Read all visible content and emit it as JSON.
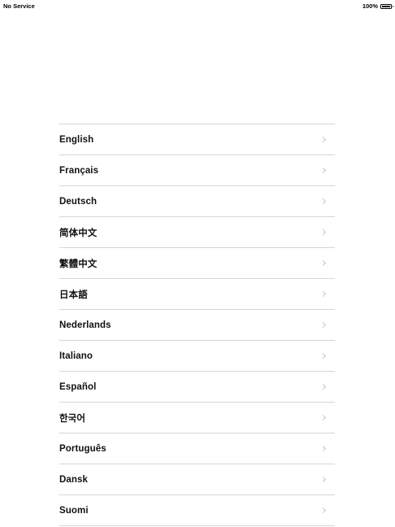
{
  "status_bar": {
    "carrier": "No Service",
    "battery_percent_label": "100%",
    "battery_level": 1.0
  },
  "language_list": {
    "items": [
      {
        "label": "English"
      },
      {
        "label": "Français"
      },
      {
        "label": "Deutsch"
      },
      {
        "label": "简体中文"
      },
      {
        "label": "繁體中文"
      },
      {
        "label": "日本語"
      },
      {
        "label": "Nederlands"
      },
      {
        "label": "Italiano"
      },
      {
        "label": "Español"
      },
      {
        "label": "한국어"
      },
      {
        "label": "Português"
      },
      {
        "label": "Dansk"
      },
      {
        "label": "Suomi"
      }
    ]
  },
  "colors": {
    "separator": "#d6d6d8",
    "chevron": "#c4c4c7",
    "text": "#111111",
    "background": "#ffffff"
  }
}
